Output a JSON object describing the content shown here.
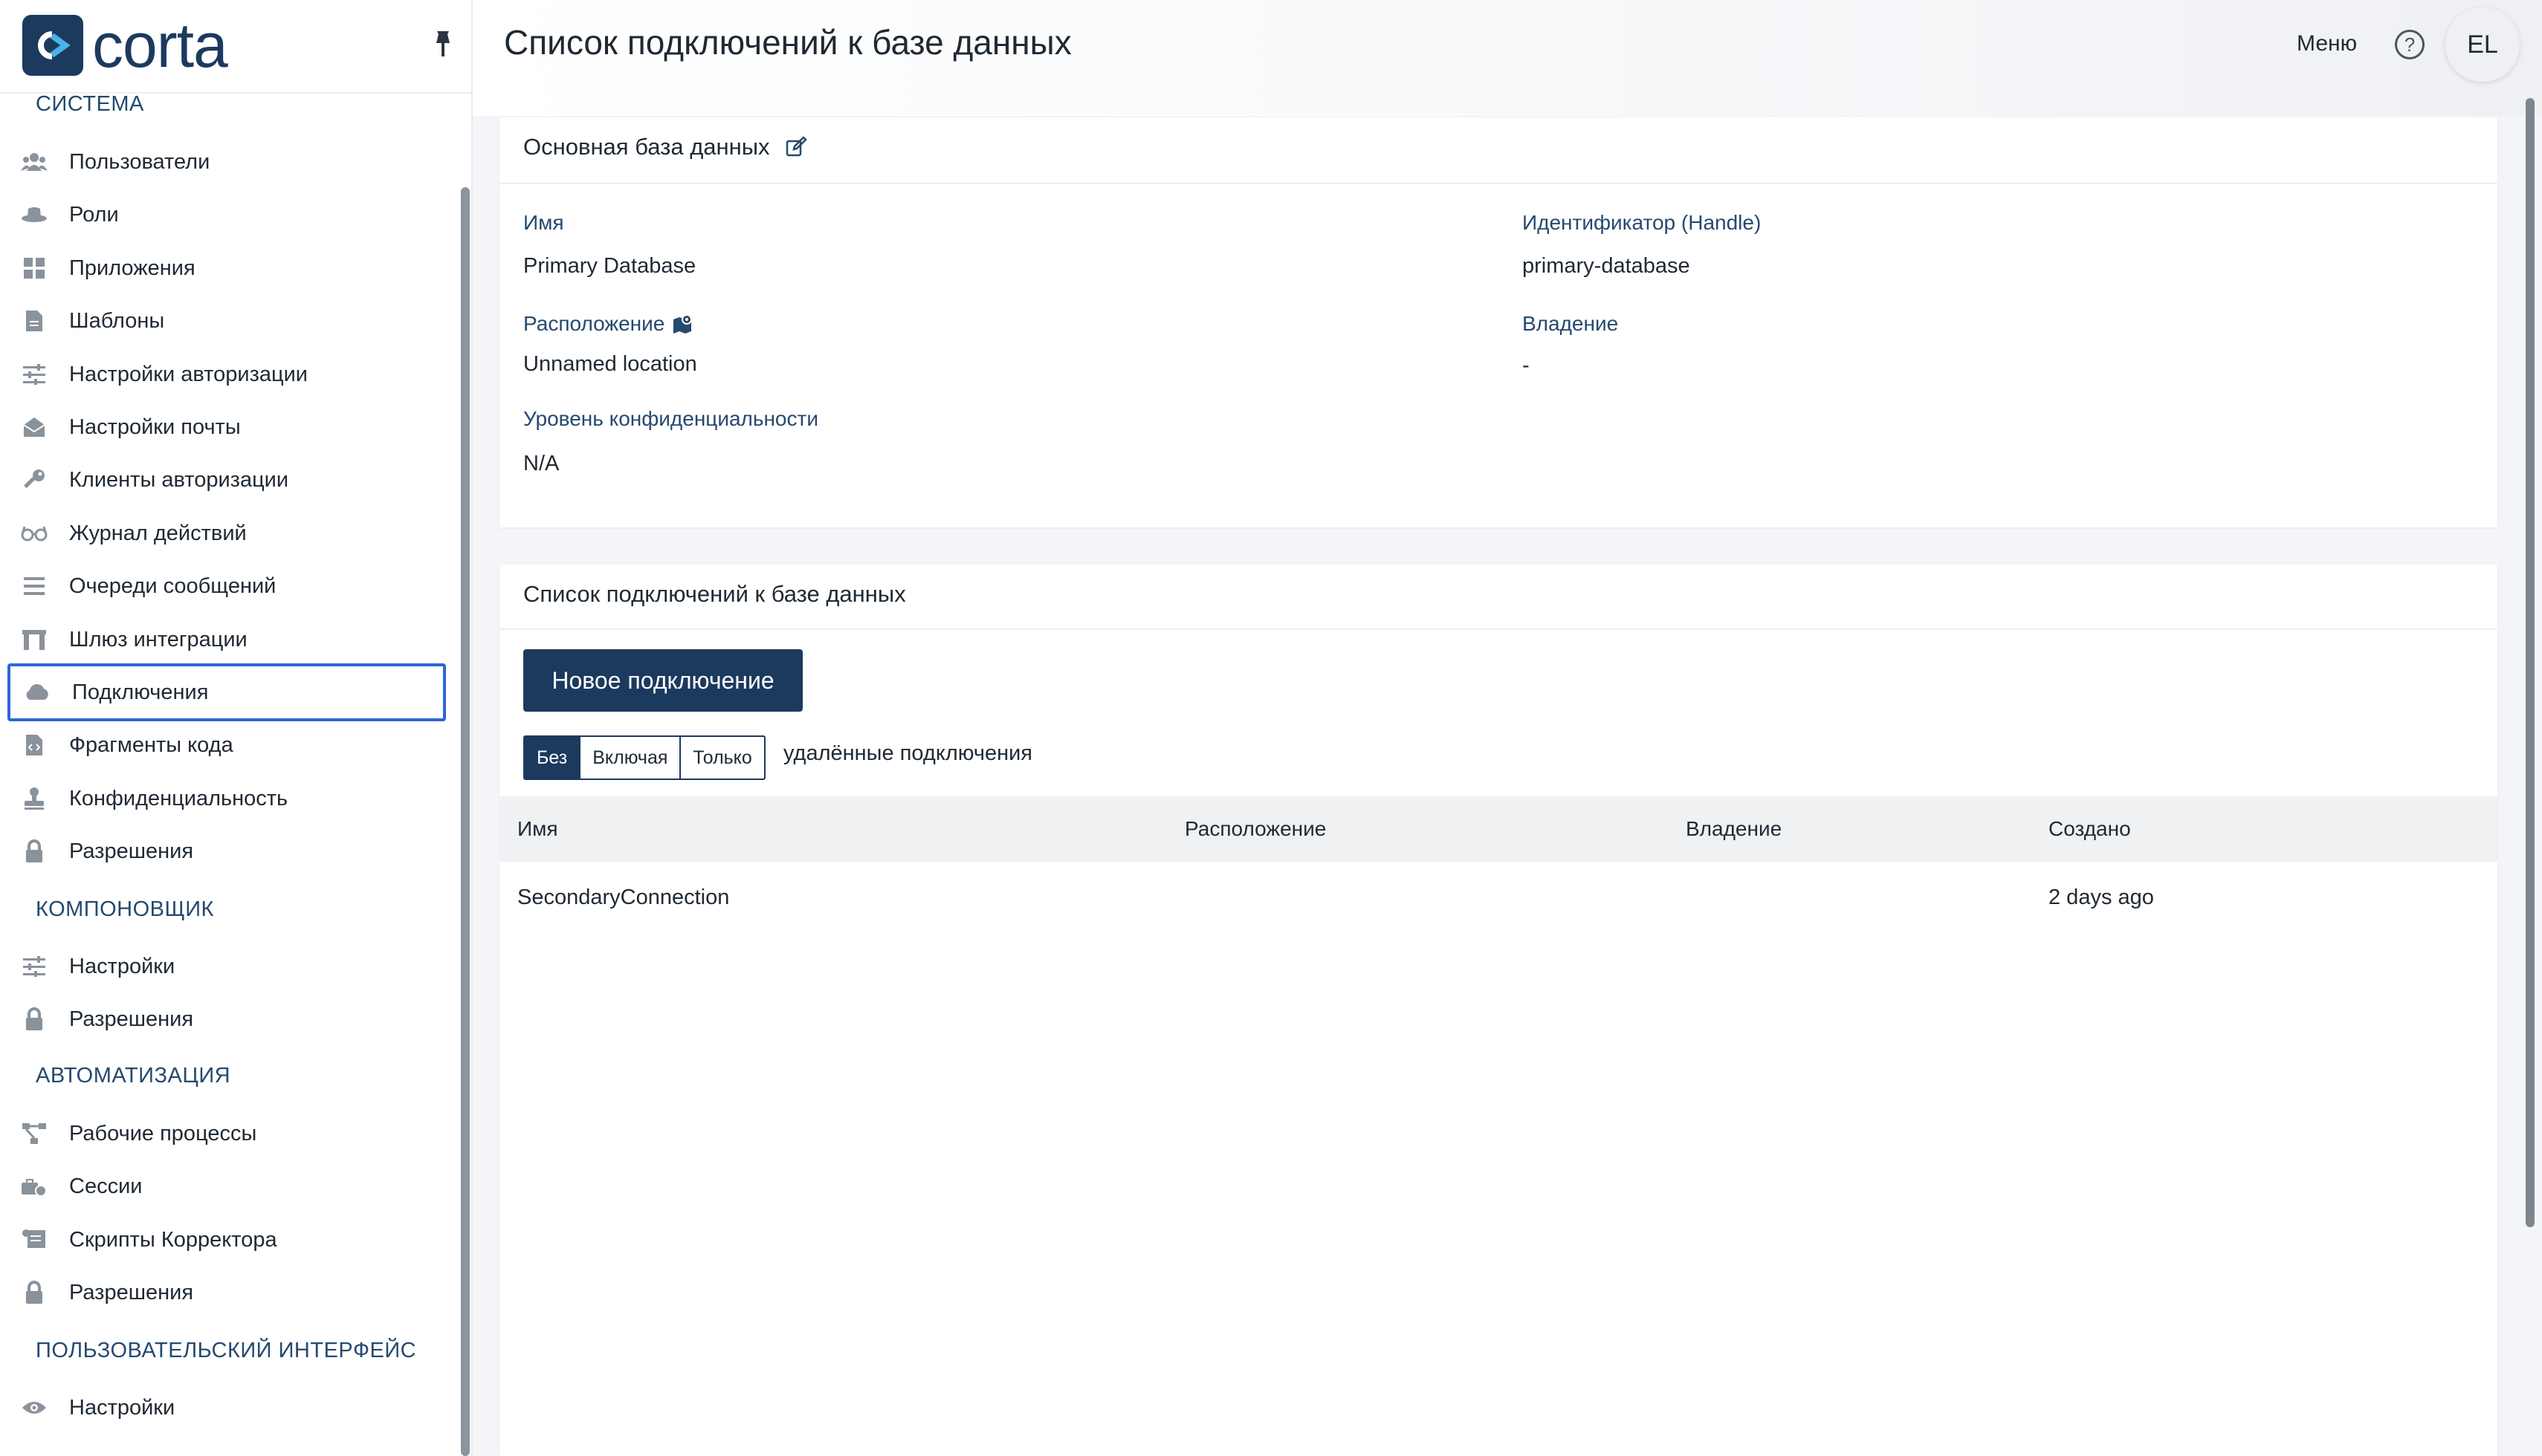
{
  "app": {
    "brand": "corta"
  },
  "header": {
    "title": "Список подключений к базе данных",
    "menu_label": "Меню",
    "help_symbol": "?",
    "avatar_initials": "EL"
  },
  "sidebar": {
    "sections": [
      {
        "title": "СИСТЕМА",
        "items": [
          {
            "label": "Пользователи",
            "icon": "users-icon"
          },
          {
            "label": "Роли",
            "icon": "hat-icon"
          },
          {
            "label": "Приложения",
            "icon": "grid-icon"
          },
          {
            "label": "Шаблоны",
            "icon": "file-template-icon"
          },
          {
            "label": "Настройки авторизации",
            "icon": "sliders-icon"
          },
          {
            "label": "Настройки почты",
            "icon": "envelope-open-icon"
          },
          {
            "label": "Клиенты авторизации",
            "icon": "key-icon"
          },
          {
            "label": "Журнал действий",
            "icon": "glasses-icon"
          },
          {
            "label": "Очереди сообщений",
            "icon": "list-icon"
          },
          {
            "label": "Шлюз интеграции",
            "icon": "gateway-icon"
          },
          {
            "label": "Подключения",
            "icon": "cloud-icon",
            "active": true
          },
          {
            "label": "Фрагменты кода",
            "icon": "file-code-icon"
          },
          {
            "label": "Конфиденциальность",
            "icon": "stamp-icon"
          },
          {
            "label": "Разрешения",
            "icon": "lock-icon"
          }
        ]
      },
      {
        "title": "КОМПОНОВЩИК",
        "items": [
          {
            "label": "Настройки",
            "icon": "sliders-icon"
          },
          {
            "label": "Разрешения",
            "icon": "lock-icon"
          }
        ]
      },
      {
        "title": "АВТОМАТИЗАЦИЯ",
        "items": [
          {
            "label": "Рабочие процессы",
            "icon": "workflow-icon"
          },
          {
            "label": "Сессии",
            "icon": "sessions-icon"
          },
          {
            "label": "Скрипты Корректора",
            "icon": "scroll-icon"
          },
          {
            "label": "Разрешения",
            "icon": "lock-icon"
          }
        ]
      },
      {
        "title": "ПОЛЬЗОВАТЕЛЬСКИЙ ИНТЕРФЕЙС",
        "items": [
          {
            "label": "Настройки",
            "icon": "eye-icon"
          }
        ]
      }
    ]
  },
  "database": {
    "heading": "Основная база данных",
    "name_label": "Имя",
    "name_value": "Primary Database",
    "handle_label": "Идентификатор (Handle)",
    "handle_value": "primary-database",
    "location_label": "Расположение",
    "location_value": "Unnamed location",
    "ownership_label": "Владение",
    "ownership_value": "-",
    "sensitivity_label": "Уровень конфиденциальности",
    "sensitivity_value": "N/A"
  },
  "connections": {
    "heading": "Список подключений к базе данных",
    "new_button": "Новое подключение",
    "filter_options": [
      "Без",
      "Включая",
      "Только"
    ],
    "filter_selected": "Без",
    "filter_suffix": "удалённые подключения",
    "columns": [
      "Имя",
      "Расположение",
      "Владение",
      "Создано"
    ],
    "rows": [
      {
        "name": "SecondaryConnection",
        "location": "",
        "ownership": "",
        "created": "2 days ago"
      }
    ]
  },
  "colors": {
    "brand": "#1c3a5e",
    "active_outline": "#2f63d8",
    "label": "#25496f"
  }
}
